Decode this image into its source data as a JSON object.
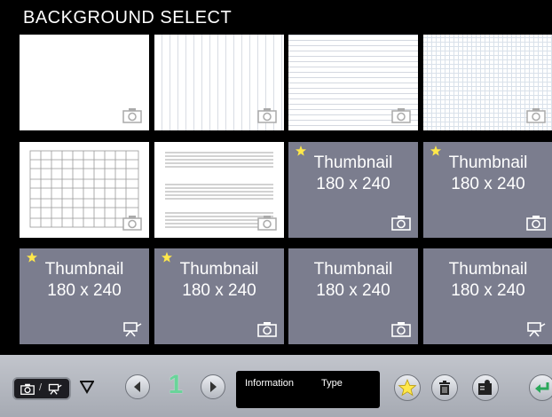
{
  "header": {
    "title": "BACKGROUND SELECT"
  },
  "tiles": [
    {
      "kind": "white",
      "pattern": "blank",
      "icon": "camera-icon"
    },
    {
      "kind": "white",
      "pattern": "vertical-lines",
      "icon": "camera-icon"
    },
    {
      "kind": "white",
      "pattern": "horizontal-lines",
      "icon": "camera-icon"
    },
    {
      "kind": "white",
      "pattern": "grid",
      "icon": "camera-icon"
    },
    {
      "kind": "white",
      "pattern": "music-grid",
      "icon": "camera-icon"
    },
    {
      "kind": "white",
      "pattern": "staff-lines",
      "icon": "camera-icon"
    },
    {
      "kind": "thumb",
      "line1": "Thumbnail",
      "line2": "180 x 240",
      "star": true,
      "icon": "camera-icon"
    },
    {
      "kind": "thumb",
      "line1": "Thumbnail",
      "line2": "180 x 240",
      "star": true,
      "icon": "camera-icon"
    },
    {
      "kind": "thumb",
      "line1": "Thumbnail",
      "line2": "180 x 240",
      "star": true,
      "icon": "projector-icon"
    },
    {
      "kind": "thumb",
      "line1": "Thumbnail",
      "line2": "180 x 240",
      "star": true,
      "icon": "camera-icon"
    },
    {
      "kind": "thumb",
      "line1": "Thumbnail",
      "line2": "180 x 240",
      "star": false,
      "icon": "camera-icon"
    },
    {
      "kind": "thumb",
      "line1": "Thumbnail",
      "line2": "180 x 240",
      "star": false,
      "icon": "projector-icon"
    }
  ],
  "toolbar": {
    "page_number": "1",
    "mode_separator": "/",
    "info": {
      "label1": "Information",
      "label2": "Type"
    }
  },
  "colors": {
    "thumb_bg": "#7b7d8e",
    "page_number": "#6ad49a",
    "star": "#ffe84a",
    "return_arrow": "#2aa85a"
  }
}
